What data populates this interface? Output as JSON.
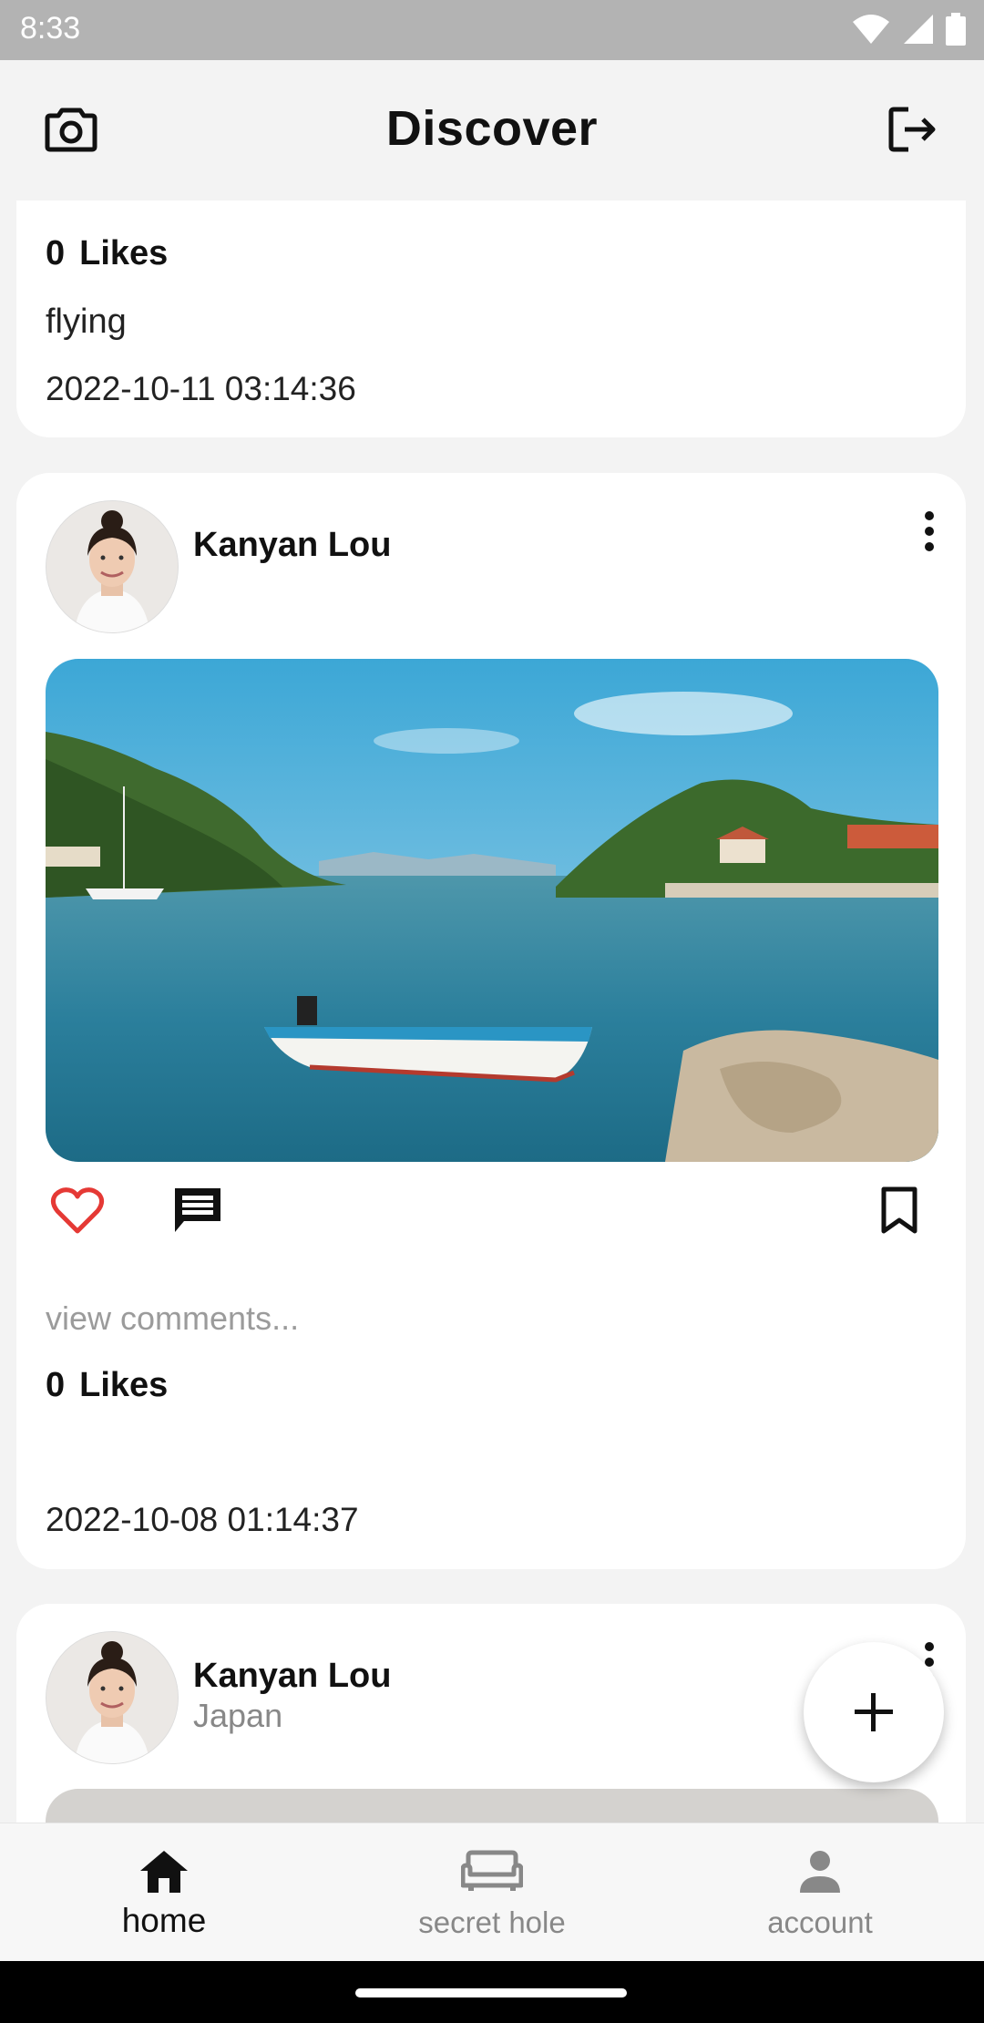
{
  "status": {
    "time": "8:33"
  },
  "header": {
    "title": "Discover"
  },
  "posts": [
    {
      "likes_count": "0",
      "likes_label": "Likes",
      "caption": "flying",
      "timestamp": "2022-10-11 03:14:36"
    },
    {
      "author": "Kanyan Lou",
      "likes_count": "0",
      "likes_label": "Likes",
      "view_comments": "view comments...",
      "timestamp": "2022-10-08 01:14:37"
    },
    {
      "author": "Kanyan Lou",
      "location": "Japan"
    }
  ],
  "nav": {
    "items": [
      {
        "label": "home",
        "icon": "home-icon",
        "active": true
      },
      {
        "label": "secret hole",
        "icon": "couch-icon",
        "active": false
      },
      {
        "label": "account",
        "icon": "person-icon",
        "active": false
      }
    ]
  },
  "colors": {
    "like": "#e53935",
    "accent": "#111111"
  }
}
